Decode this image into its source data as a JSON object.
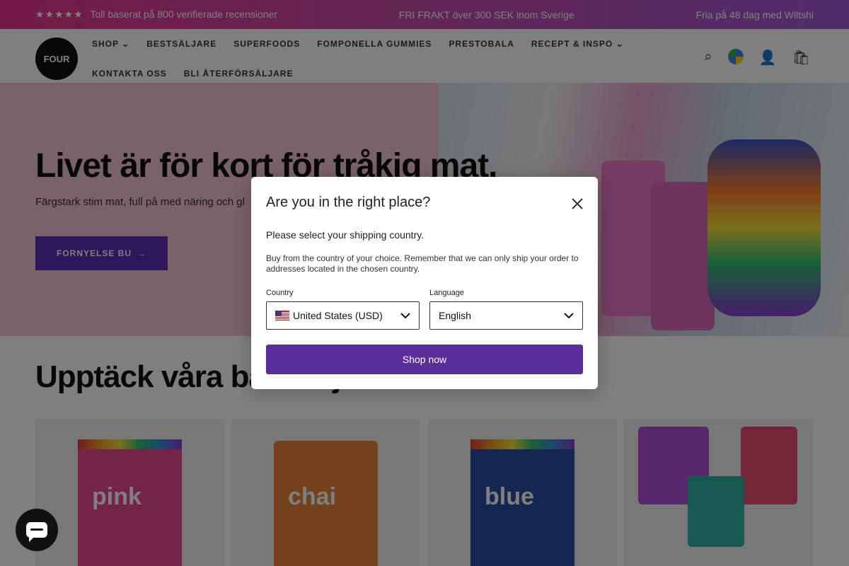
{
  "announcement": {
    "left": "Toll baserat på 800 verifierade recensioner",
    "left_stars": "★★★★★",
    "center": "FRI FRAKT över 300 SEK inom Sverige",
    "right": "Fria på 48 dag med Wiltshi"
  },
  "header": {
    "logo_text": "FOUR",
    "nav": [
      "SHOP ⌄",
      "BESTSÄLJARE",
      "SUPERFOODS",
      "FOMPONELLA GUMMIES",
      "PRESTOBALA",
      "RECEPT & INSPO ⌄",
      "KONTAKTA OSS",
      "BLI ÅTERFÖRSÄLJARE"
    ]
  },
  "hero": {
    "title": "Livet är för kort för tråkig mat.",
    "subtitle": "Färgstark stim mat, full på med näring och gl",
    "button_label": "FORNYELSE BU",
    "button_arrow": "→"
  },
  "section": {
    "title": "Upptäck våra bästsäljare"
  },
  "products": [
    {
      "label": "pink",
      "color": "#e84a8e"
    },
    {
      "label": "chai",
      "color": "#e8823a"
    },
    {
      "label": "blue",
      "color": "#2c4f9e"
    },
    {
      "label": "",
      "color": "#b34fd6"
    }
  ],
  "modal": {
    "title": "Are you in the right place?",
    "lead": "Please select your shipping country.",
    "description": "Buy from the country of your choice. Remember that we can only ship your order to addresses located in the chosen country.",
    "country_label": "Country",
    "country_value": "United States (USD)",
    "language_label": "Language",
    "language_value": "English",
    "shop_button": "Shop now"
  },
  "colors": {
    "primary_purple": "#5b2d9a",
    "hero_pink": "#f4c5d4"
  }
}
